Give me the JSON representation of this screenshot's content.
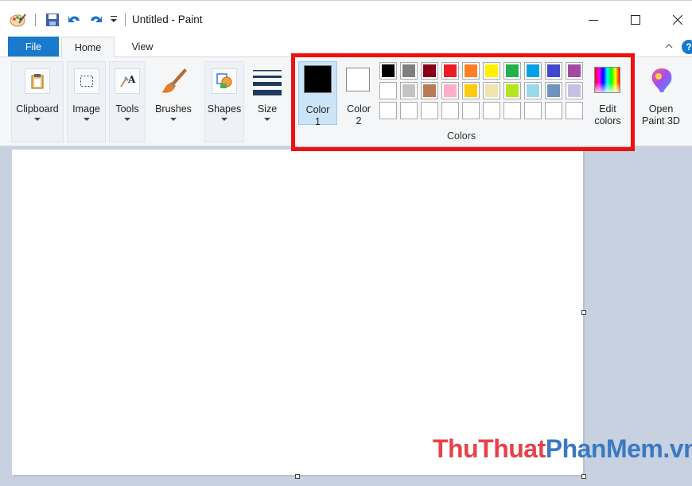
{
  "window": {
    "title": "Untitled - Paint"
  },
  "tabs": [
    {
      "label": "File"
    },
    {
      "label": "Home"
    },
    {
      "label": "View"
    }
  ],
  "help_label": "?",
  "ribbon": {
    "groups": [
      {
        "label": "Clipboard",
        "icon": "clipboard-icon"
      },
      {
        "label": "Image",
        "icon": "select-icon"
      },
      {
        "label": "Tools",
        "icon": "tools-icon"
      },
      {
        "label": "Brushes",
        "icon": "brush-icon"
      },
      {
        "label": "Shapes",
        "icon": "shapes-icon"
      },
      {
        "label": "Size",
        "icon": "size-icon"
      }
    ],
    "colors": {
      "color1_label": "Color\n1",
      "color1_value": "#000000",
      "color2_label": "Color\n2",
      "color2_value": "#ffffff",
      "group_label": "Colors",
      "edit_colors_label": "Edit\ncolors",
      "palette_row1": [
        "#000000",
        "#7f7f7f",
        "#880015",
        "#ed1c24",
        "#ff7f27",
        "#fff200",
        "#22b14c",
        "#00a2e8",
        "#3f48cc",
        "#a349a4"
      ],
      "palette_row2": [
        "#ffffff",
        "#c3c3c3",
        "#b97a57",
        "#ffaec9",
        "#ffc90e",
        "#efe4b0",
        "#b5e61d",
        "#99d9ea",
        "#7092be",
        "#c8bfe7"
      ],
      "palette_row3": [
        "",
        "",
        "",
        "",
        "",
        "",
        "",
        "",
        "",
        ""
      ]
    },
    "open_paint3d_label": "Open\nPaint 3D"
  },
  "highlight_color": "#ee1111",
  "watermark": {
    "part1": "ThuThuat",
    "part2": "PhanMem.vn"
  }
}
